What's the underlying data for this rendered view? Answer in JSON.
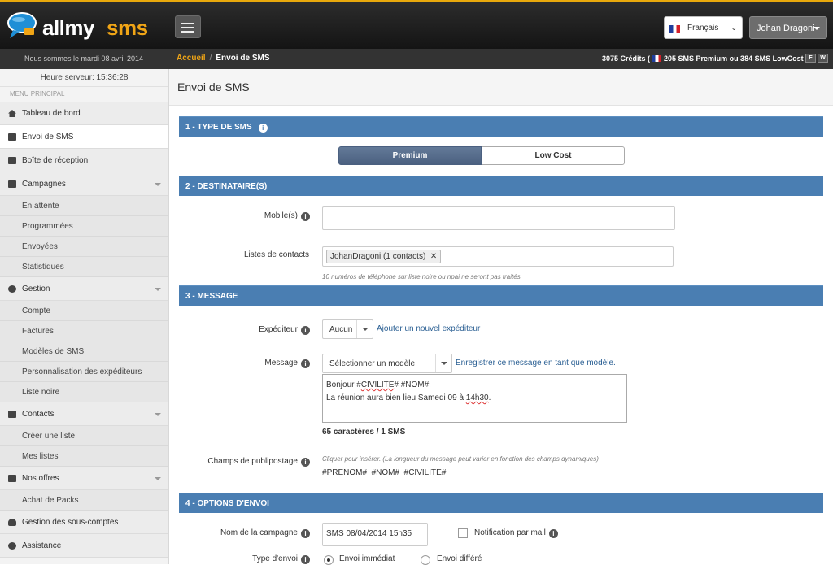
{
  "app": {
    "logo_part1": "allmy",
    "logo_part2": "sms"
  },
  "header": {
    "language": "Français",
    "user": "Johan Dragoni"
  },
  "subbar": {
    "date": "Nous sommes le mardi 08 avril 2014",
    "breadcrumb_home": "Accueil",
    "breadcrumb_sep": "/",
    "breadcrumb_current": "Envoi de SMS",
    "credits_before": "3075 Crédits (",
    "credits_after": "205 SMS Premium ou 384 SMS LowCost )",
    "btn_f": "F",
    "btn_w": "W"
  },
  "sidebar": {
    "server_time": "Heure serveur: 15:36:28",
    "menu_title": "MENU PRINCIPAL",
    "items": [
      {
        "label": "Tableau de bord"
      },
      {
        "label": "Envoi de SMS"
      },
      {
        "label": "Boîte de réception"
      },
      {
        "label": "Campagnes"
      },
      {
        "label": "Gestion"
      },
      {
        "label": "Contacts"
      },
      {
        "label": "Nos offres"
      },
      {
        "label": "Gestion des sous-comptes"
      },
      {
        "label": "Assistance"
      }
    ],
    "campagnes_sub": [
      "En attente",
      "Programmées",
      "Envoyées",
      "Statistiques"
    ],
    "gestion_sub": [
      "Compte",
      "Factures",
      "Modèles de SMS",
      "Personnalisation des expéditeurs",
      "Liste noire"
    ],
    "contacts_sub": [
      "Créer une liste",
      "Mes listes"
    ],
    "offres_sub": [
      "Achat de Packs"
    ]
  },
  "main": {
    "title": "Envoi de SMS",
    "s1": {
      "title": "1 - TYPE DE SMS",
      "opt_premium": "Premium",
      "opt_lowcost": "Low Cost"
    },
    "s2": {
      "title": "2 - DESTINATAIRE(S)",
      "mobiles_label": "Mobile(s)",
      "mobiles_value": "",
      "lists_label": "Listes de contacts",
      "list_tag": "JohanDragoni (1 contacts)",
      "hint": "10 numéros de téléphone sur liste noire ou npai ne seront pas traités"
    },
    "s3": {
      "title": "3 - MESSAGE",
      "sender_label": "Expéditeur",
      "sender_value": "Aucun",
      "add_sender_link": "Ajouter un nouvel expéditeur",
      "message_label": "Message",
      "template_placeholder": "Sélectionner un modèle",
      "save_template_link": "Enregistrer ce message en tant que modèle.",
      "msg_line1_a": "Bonjour #",
      "msg_line1_b": "CIVILITE",
      "msg_line1_c": "# #NOM#,",
      "msg_line2_a": "La réunion aura bien lieu Samedi 09 à ",
      "msg_line2_b": "14h30",
      "msg_line2_c": ".",
      "count": "65 caractères / 1 SMS",
      "fields_label": "Champs de publipostage",
      "fields_hint": "Cliquer pour insérer. (La longueur du message peut varier en fonction des champs dynamiques)",
      "field1": "PRENOM",
      "field2": "NOM",
      "field3": "CIVILITE"
    },
    "s4": {
      "title": "4 - OPTIONS D'ENVOI",
      "campaign_label": "Nom de la campagne",
      "campaign_value": "SMS 08/04/2014  15h35",
      "notif_label": "Notification par mail",
      "send_type_label": "Type d'envoi",
      "send_now": "Envoi immédiat",
      "send_later": "Envoi différé"
    }
  }
}
